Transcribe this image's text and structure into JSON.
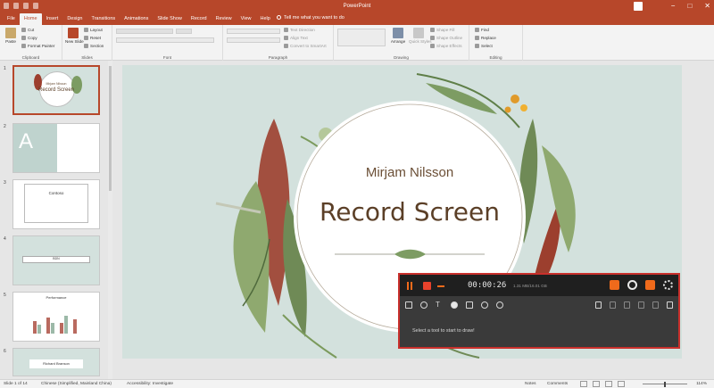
{
  "window": {
    "title": "PowerPoint"
  },
  "tabs": [
    "File",
    "Home",
    "Insert",
    "Design",
    "Transitions",
    "Animations",
    "Slide Show",
    "Record",
    "Review",
    "View",
    "Help"
  ],
  "tell_me": "Tell me what you want to do",
  "ribbon": {
    "clipboard": {
      "label": "Clipboard",
      "paste": "Paste",
      "cut": "Cut",
      "copy": "Copy",
      "format_painter": "Format Painter"
    },
    "slides": {
      "label": "Slides",
      "new_slide": "New Slide",
      "layout": "Layout",
      "reset": "Reset",
      "section": "Section"
    },
    "font": {
      "label": "Font"
    },
    "paragraph": {
      "label": "Paragraph",
      "text_direction": "Text Direction",
      "align_text": "Align Text",
      "convert": "Convert to SmartArt"
    },
    "drawing": {
      "label": "Drawing",
      "arrange": "Arrange",
      "quick_styles": "Quick Styles",
      "shape_fill": "Shape Fill",
      "shape_outline": "Shape Outline",
      "shape_effects": "Shape Effects"
    },
    "editing": {
      "label": "Editing",
      "find": "Find",
      "replace": "Replace",
      "select": "Select"
    }
  },
  "thumbnails": [
    {
      "num": "1",
      "title": "Record Screen",
      "subtitle": "Mirjam Nilsson"
    },
    {
      "num": "2",
      "title": "A"
    },
    {
      "num": "3",
      "title": "Contoso"
    },
    {
      "num": "4",
      "title": "BDN"
    },
    {
      "num": "5",
      "title": "Performance"
    },
    {
      "num": "6",
      "title": "Richard Branson"
    }
  ],
  "slide": {
    "author": "Mirjam Nilsson",
    "title": "Record Screen"
  },
  "recorder": {
    "timer": "00:00:26",
    "file_size": "1.31 MB/16.01 GB",
    "hint": "Select a tool to start to draw!",
    "colors": {
      "accent": "#f06a1b",
      "stop": "#e8422c",
      "border": "#c9302c"
    }
  },
  "statusbar": {
    "slide_count": "Slide 1 of 14",
    "language": "Chinese (Simplified, Mainland China)",
    "accessibility": "Accessibility: Investigate",
    "notes": "Notes",
    "comments": "Comments",
    "zoom": "114%"
  },
  "colors": {
    "brand": "#b7472a",
    "slide_bg": "#d3e1dd"
  }
}
